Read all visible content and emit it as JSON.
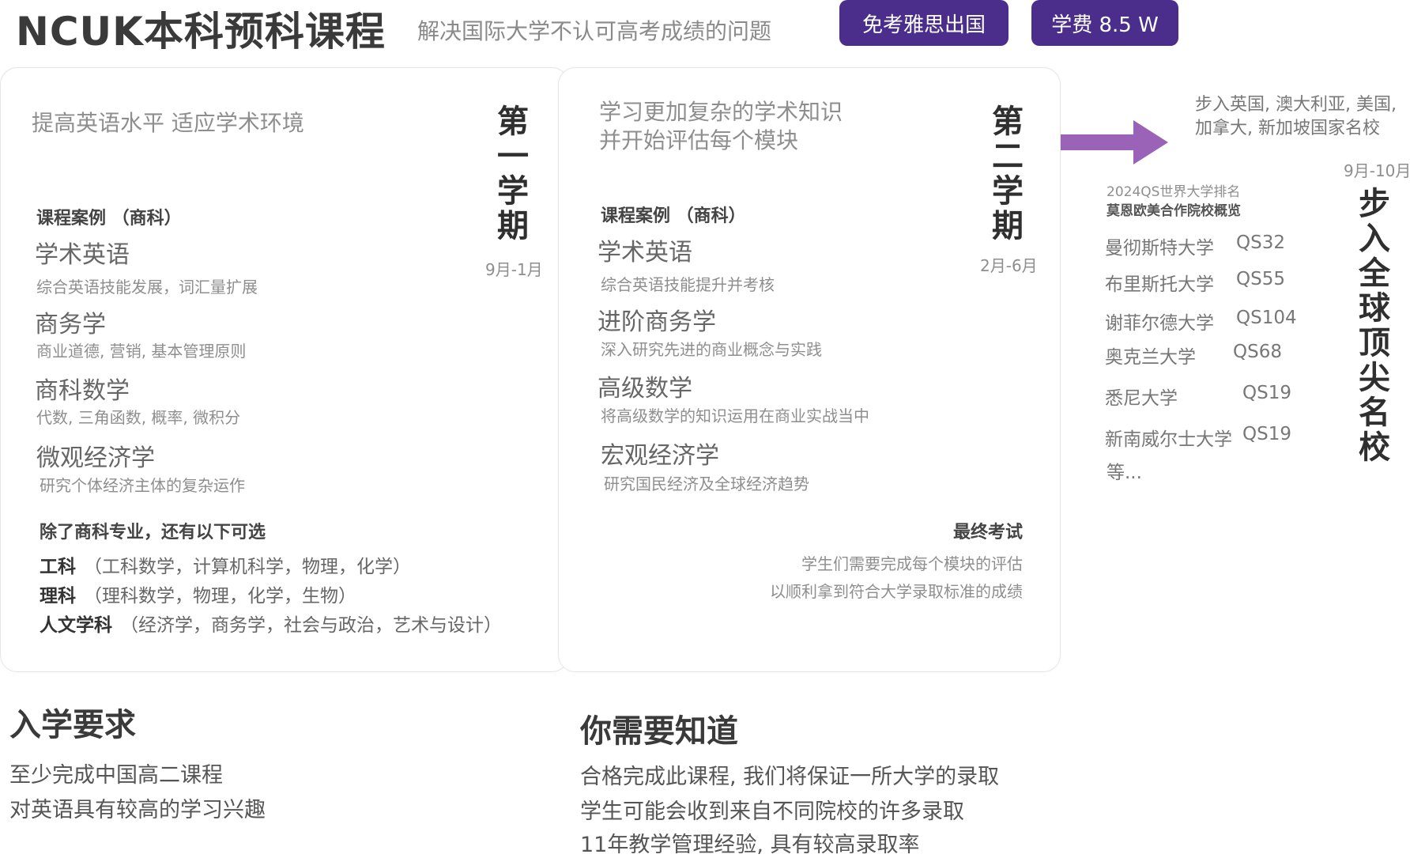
{
  "header": {
    "title": "NCUK本科预科课程",
    "subtitle": "解决国际大学不认可高考成绩的问题",
    "badges": [
      "免考雅思出国",
      "学费 8.5 W"
    ]
  },
  "colors": {
    "accent": "#4b2d8c",
    "arrow": "#9b63b7"
  },
  "term1": {
    "intro": "提高英语水平 适应学术环境",
    "label": "第一学期",
    "chars": [
      "第",
      "一",
      "学",
      "期"
    ],
    "date": "9月-1月",
    "case_heading": "课程案例 （商科）",
    "courses": [
      {
        "name": "学术英语",
        "desc": "综合英语技能发展，词汇量扩展"
      },
      {
        "name": "商务学",
        "desc": "商业道德, 营销, 基本管理原则"
      },
      {
        "name": "商科数学",
        "desc": "代数, 三角函数, 概率, 微积分"
      },
      {
        "name": "微观经济学",
        "desc": "研究个体经济主体的复杂运作"
      }
    ],
    "options_heading": "除了商科专业，还有以下可选",
    "options": [
      {
        "name": "工科",
        "items": "（工科数学，计算机科学，物理，化学）"
      },
      {
        "name": "理科",
        "items": "（理科数学，物理，化学，生物）"
      },
      {
        "name": "人文学科",
        "items": "（经济学，商务学，社会与政治，艺术与设计）"
      }
    ]
  },
  "term2": {
    "intro": [
      "学习更加复杂的学术知识",
      "并开始评估每个模块"
    ],
    "label": "第二学期",
    "chars": [
      "第",
      "二",
      "学",
      "期"
    ],
    "date": "2月-6月",
    "case_heading": "课程案例 （商科）",
    "courses": [
      {
        "name": "学术英语",
        "desc": "综合英语技能提升并考核"
      },
      {
        "name": "进阶商务学",
        "desc": "深入研究先进的商业概念与实践"
      },
      {
        "name": "高级数学",
        "desc": "将高级数学的知识运用在商业实战当中"
      },
      {
        "name": "宏观经济学",
        "desc": "研究国民经济及全球经济趋势"
      }
    ],
    "exam": {
      "heading": "最终考试",
      "lines": [
        "学生们需要完成每个模块的评估",
        "以顺利拿到符合大学录取标准的成绩"
      ]
    }
  },
  "destination": {
    "lines": [
      "步入英国, 澳大利亚, 美国,",
      "加拿大, 新加坡国家名校"
    ],
    "date": "9月-10月",
    "ranking_heading": "2024QS世界大学排名",
    "ranking_subheading": "莫恩欧美合作院校概览",
    "universities": [
      {
        "name": "曼彻斯特大学",
        "rank": "QS32"
      },
      {
        "name": "布里斯托大学",
        "rank": "QS55"
      },
      {
        "name": "谢菲尔德大学",
        "rank": "QS104"
      },
      {
        "name": "奥克兰大学",
        "rank": "QS68"
      },
      {
        "name": "悉尼大学",
        "rank": "QS19"
      },
      {
        "name": "新南威尔士大学",
        "rank": "QS19"
      }
    ],
    "etc": "等...",
    "slogan": "步入全球顶尖名校",
    "slogan_chars": [
      "步",
      "入",
      "全",
      "球",
      "顶",
      "尖",
      "名",
      "校"
    ]
  },
  "requirements": {
    "heading": "入学要求",
    "lines": [
      "至少完成中国高二课程",
      "对英语具有较高的学习兴趣"
    ]
  },
  "know": {
    "heading": "你需要知道",
    "lines": [
      "合格完成此课程, 我们将保证一所大学的录取",
      "学生可能会收到来自不同院校的许多录取",
      "11年教学管理经验, 具有较高录取率"
    ]
  }
}
